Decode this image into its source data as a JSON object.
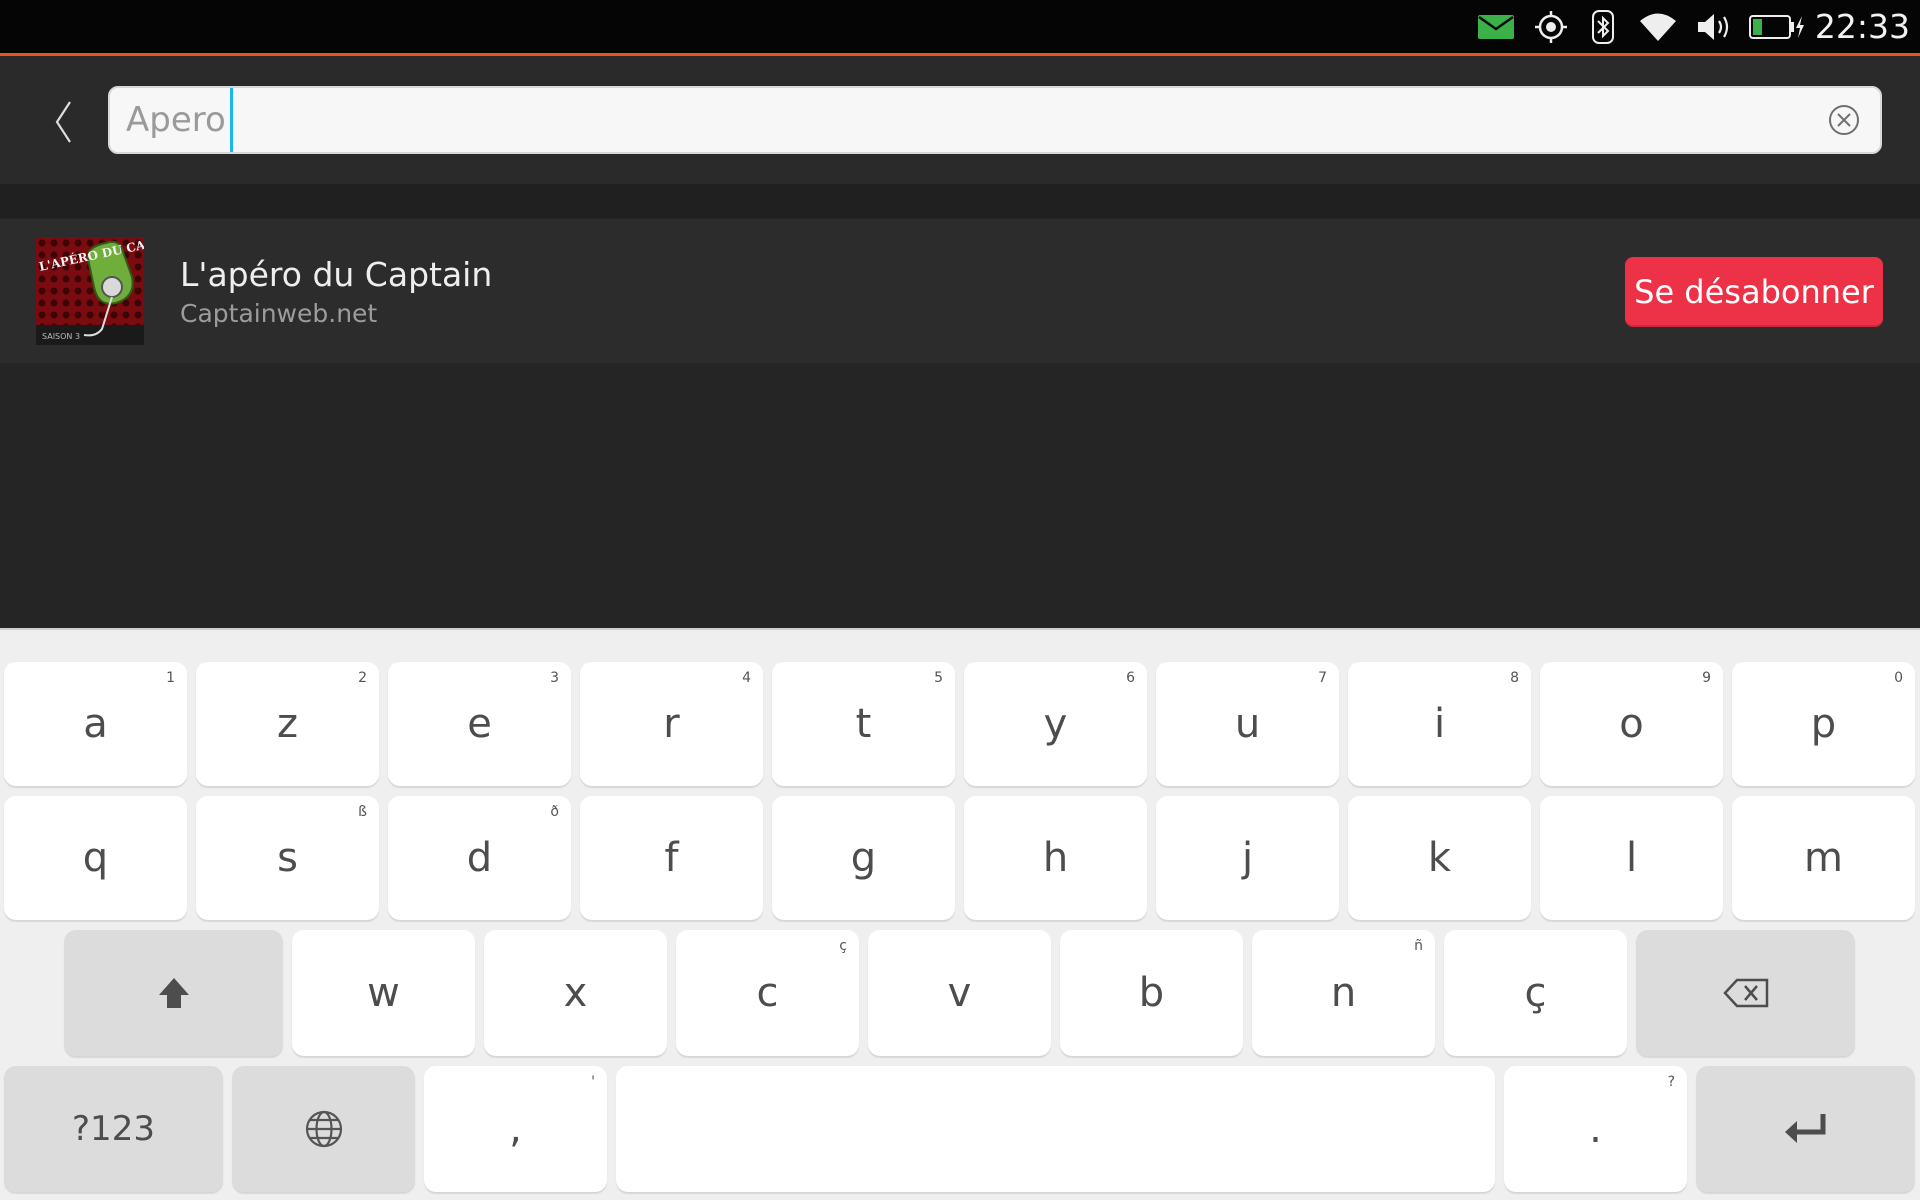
{
  "status_bar": {
    "time": "22:33",
    "icons": [
      "mail-icon",
      "location-icon",
      "bluetooth-icon",
      "wifi-icon",
      "volume-icon",
      "battery-charging-icon"
    ],
    "accent_color": "#e95420",
    "mail_icon_color": "#3cb14a"
  },
  "header": {
    "back_icon": "chevron-left-icon",
    "search": {
      "value": "Apero",
      "clear_icon": "clear-circle-icon"
    }
  },
  "results": [
    {
      "title": "L'apéro du Captain",
      "subtitle": "Captainweb.net",
      "artwork_text": "L'APÉRO DU CAPTAIN",
      "artwork_caption": "SAISON 3",
      "action_label": "Se désabonner",
      "action_color": "#ed3146"
    }
  ],
  "keyboard": {
    "rows": [
      [
        {
          "label": "a",
          "sub": "1"
        },
        {
          "label": "z",
          "sub": "2"
        },
        {
          "label": "e",
          "sub": "3"
        },
        {
          "label": "r",
          "sub": "4"
        },
        {
          "label": "t",
          "sub": "5"
        },
        {
          "label": "y",
          "sub": "6"
        },
        {
          "label": "u",
          "sub": "7"
        },
        {
          "label": "i",
          "sub": "8"
        },
        {
          "label": "o",
          "sub": "9"
        },
        {
          "label": "p",
          "sub": "0"
        }
      ],
      [
        {
          "label": "q",
          "sub": ""
        },
        {
          "label": "s",
          "sub": "ß"
        },
        {
          "label": "d",
          "sub": "ð"
        },
        {
          "label": "f",
          "sub": ""
        },
        {
          "label": "g",
          "sub": ""
        },
        {
          "label": "h",
          "sub": ""
        },
        {
          "label": "j",
          "sub": ""
        },
        {
          "label": "k",
          "sub": ""
        },
        {
          "label": "l",
          "sub": ""
        },
        {
          "label": "m",
          "sub": ""
        }
      ],
      [
        {
          "label": "w",
          "sub": ""
        },
        {
          "label": "x",
          "sub": ""
        },
        {
          "label": "c",
          "sub": "ç"
        },
        {
          "label": "v",
          "sub": ""
        },
        {
          "label": "b",
          "sub": ""
        },
        {
          "label": "n",
          "sub": "ñ"
        },
        {
          "label": "ç",
          "sub": ""
        }
      ]
    ],
    "shift_icon": "shift-icon",
    "backspace_icon": "backspace-icon",
    "symbols_label": "?123",
    "language_icon": "globe-icon",
    "comma": {
      "label": ",",
      "sub": "'"
    },
    "period": {
      "label": ".",
      "sub": "?"
    },
    "enter_icon": "enter-icon"
  }
}
